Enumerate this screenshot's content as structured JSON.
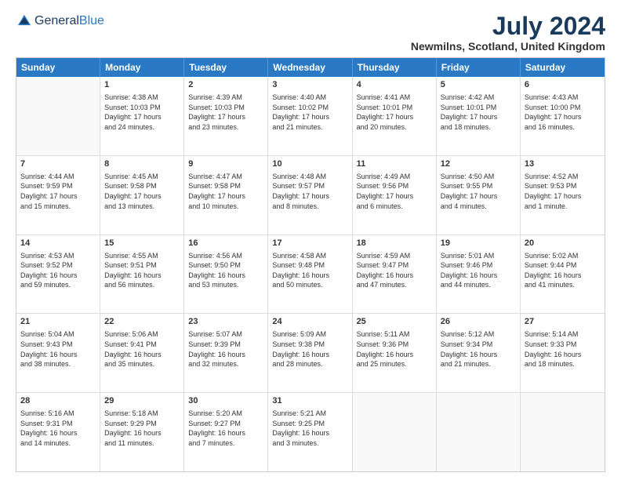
{
  "logo": {
    "general": "General",
    "blue": "Blue"
  },
  "header": {
    "month_year": "July 2024",
    "location": "Newmilns, Scotland, United Kingdom"
  },
  "days": [
    "Sunday",
    "Monday",
    "Tuesday",
    "Wednesday",
    "Thursday",
    "Friday",
    "Saturday"
  ],
  "weeks": [
    [
      {
        "day": "",
        "text": ""
      },
      {
        "day": "1",
        "text": "Sunrise: 4:38 AM\nSunset: 10:03 PM\nDaylight: 17 hours\nand 24 minutes."
      },
      {
        "day": "2",
        "text": "Sunrise: 4:39 AM\nSunset: 10:03 PM\nDaylight: 17 hours\nand 23 minutes."
      },
      {
        "day": "3",
        "text": "Sunrise: 4:40 AM\nSunset: 10:02 PM\nDaylight: 17 hours\nand 21 minutes."
      },
      {
        "day": "4",
        "text": "Sunrise: 4:41 AM\nSunset: 10:01 PM\nDaylight: 17 hours\nand 20 minutes."
      },
      {
        "day": "5",
        "text": "Sunrise: 4:42 AM\nSunset: 10:01 PM\nDaylight: 17 hours\nand 18 minutes."
      },
      {
        "day": "6",
        "text": "Sunrise: 4:43 AM\nSunset: 10:00 PM\nDaylight: 17 hours\nand 16 minutes."
      }
    ],
    [
      {
        "day": "7",
        "text": "Sunrise: 4:44 AM\nSunset: 9:59 PM\nDaylight: 17 hours\nand 15 minutes."
      },
      {
        "day": "8",
        "text": "Sunrise: 4:45 AM\nSunset: 9:58 PM\nDaylight: 17 hours\nand 13 minutes."
      },
      {
        "day": "9",
        "text": "Sunrise: 4:47 AM\nSunset: 9:58 PM\nDaylight: 17 hours\nand 10 minutes."
      },
      {
        "day": "10",
        "text": "Sunrise: 4:48 AM\nSunset: 9:57 PM\nDaylight: 17 hours\nand 8 minutes."
      },
      {
        "day": "11",
        "text": "Sunrise: 4:49 AM\nSunset: 9:56 PM\nDaylight: 17 hours\nand 6 minutes."
      },
      {
        "day": "12",
        "text": "Sunrise: 4:50 AM\nSunset: 9:55 PM\nDaylight: 17 hours\nand 4 minutes."
      },
      {
        "day": "13",
        "text": "Sunrise: 4:52 AM\nSunset: 9:53 PM\nDaylight: 17 hours\nand 1 minute."
      }
    ],
    [
      {
        "day": "14",
        "text": "Sunrise: 4:53 AM\nSunset: 9:52 PM\nDaylight: 16 hours\nand 59 minutes."
      },
      {
        "day": "15",
        "text": "Sunrise: 4:55 AM\nSunset: 9:51 PM\nDaylight: 16 hours\nand 56 minutes."
      },
      {
        "day": "16",
        "text": "Sunrise: 4:56 AM\nSunset: 9:50 PM\nDaylight: 16 hours\nand 53 minutes."
      },
      {
        "day": "17",
        "text": "Sunrise: 4:58 AM\nSunset: 9:48 PM\nDaylight: 16 hours\nand 50 minutes."
      },
      {
        "day": "18",
        "text": "Sunrise: 4:59 AM\nSunset: 9:47 PM\nDaylight: 16 hours\nand 47 minutes."
      },
      {
        "day": "19",
        "text": "Sunrise: 5:01 AM\nSunset: 9:46 PM\nDaylight: 16 hours\nand 44 minutes."
      },
      {
        "day": "20",
        "text": "Sunrise: 5:02 AM\nSunset: 9:44 PM\nDaylight: 16 hours\nand 41 minutes."
      }
    ],
    [
      {
        "day": "21",
        "text": "Sunrise: 5:04 AM\nSunset: 9:43 PM\nDaylight: 16 hours\nand 38 minutes."
      },
      {
        "day": "22",
        "text": "Sunrise: 5:06 AM\nSunset: 9:41 PM\nDaylight: 16 hours\nand 35 minutes."
      },
      {
        "day": "23",
        "text": "Sunrise: 5:07 AM\nSunset: 9:39 PM\nDaylight: 16 hours\nand 32 minutes."
      },
      {
        "day": "24",
        "text": "Sunrise: 5:09 AM\nSunset: 9:38 PM\nDaylight: 16 hours\nand 28 minutes."
      },
      {
        "day": "25",
        "text": "Sunrise: 5:11 AM\nSunset: 9:36 PM\nDaylight: 16 hours\nand 25 minutes."
      },
      {
        "day": "26",
        "text": "Sunrise: 5:12 AM\nSunset: 9:34 PM\nDaylight: 16 hours\nand 21 minutes."
      },
      {
        "day": "27",
        "text": "Sunrise: 5:14 AM\nSunset: 9:33 PM\nDaylight: 16 hours\nand 18 minutes."
      }
    ],
    [
      {
        "day": "28",
        "text": "Sunrise: 5:16 AM\nSunset: 9:31 PM\nDaylight: 16 hours\nand 14 minutes."
      },
      {
        "day": "29",
        "text": "Sunrise: 5:18 AM\nSunset: 9:29 PM\nDaylight: 16 hours\nand 11 minutes."
      },
      {
        "day": "30",
        "text": "Sunrise: 5:20 AM\nSunset: 9:27 PM\nDaylight: 16 hours\nand 7 minutes."
      },
      {
        "day": "31",
        "text": "Sunrise: 5:21 AM\nSunset: 9:25 PM\nDaylight: 16 hours\nand 3 minutes."
      },
      {
        "day": "",
        "text": ""
      },
      {
        "day": "",
        "text": ""
      },
      {
        "day": "",
        "text": ""
      }
    ]
  ]
}
